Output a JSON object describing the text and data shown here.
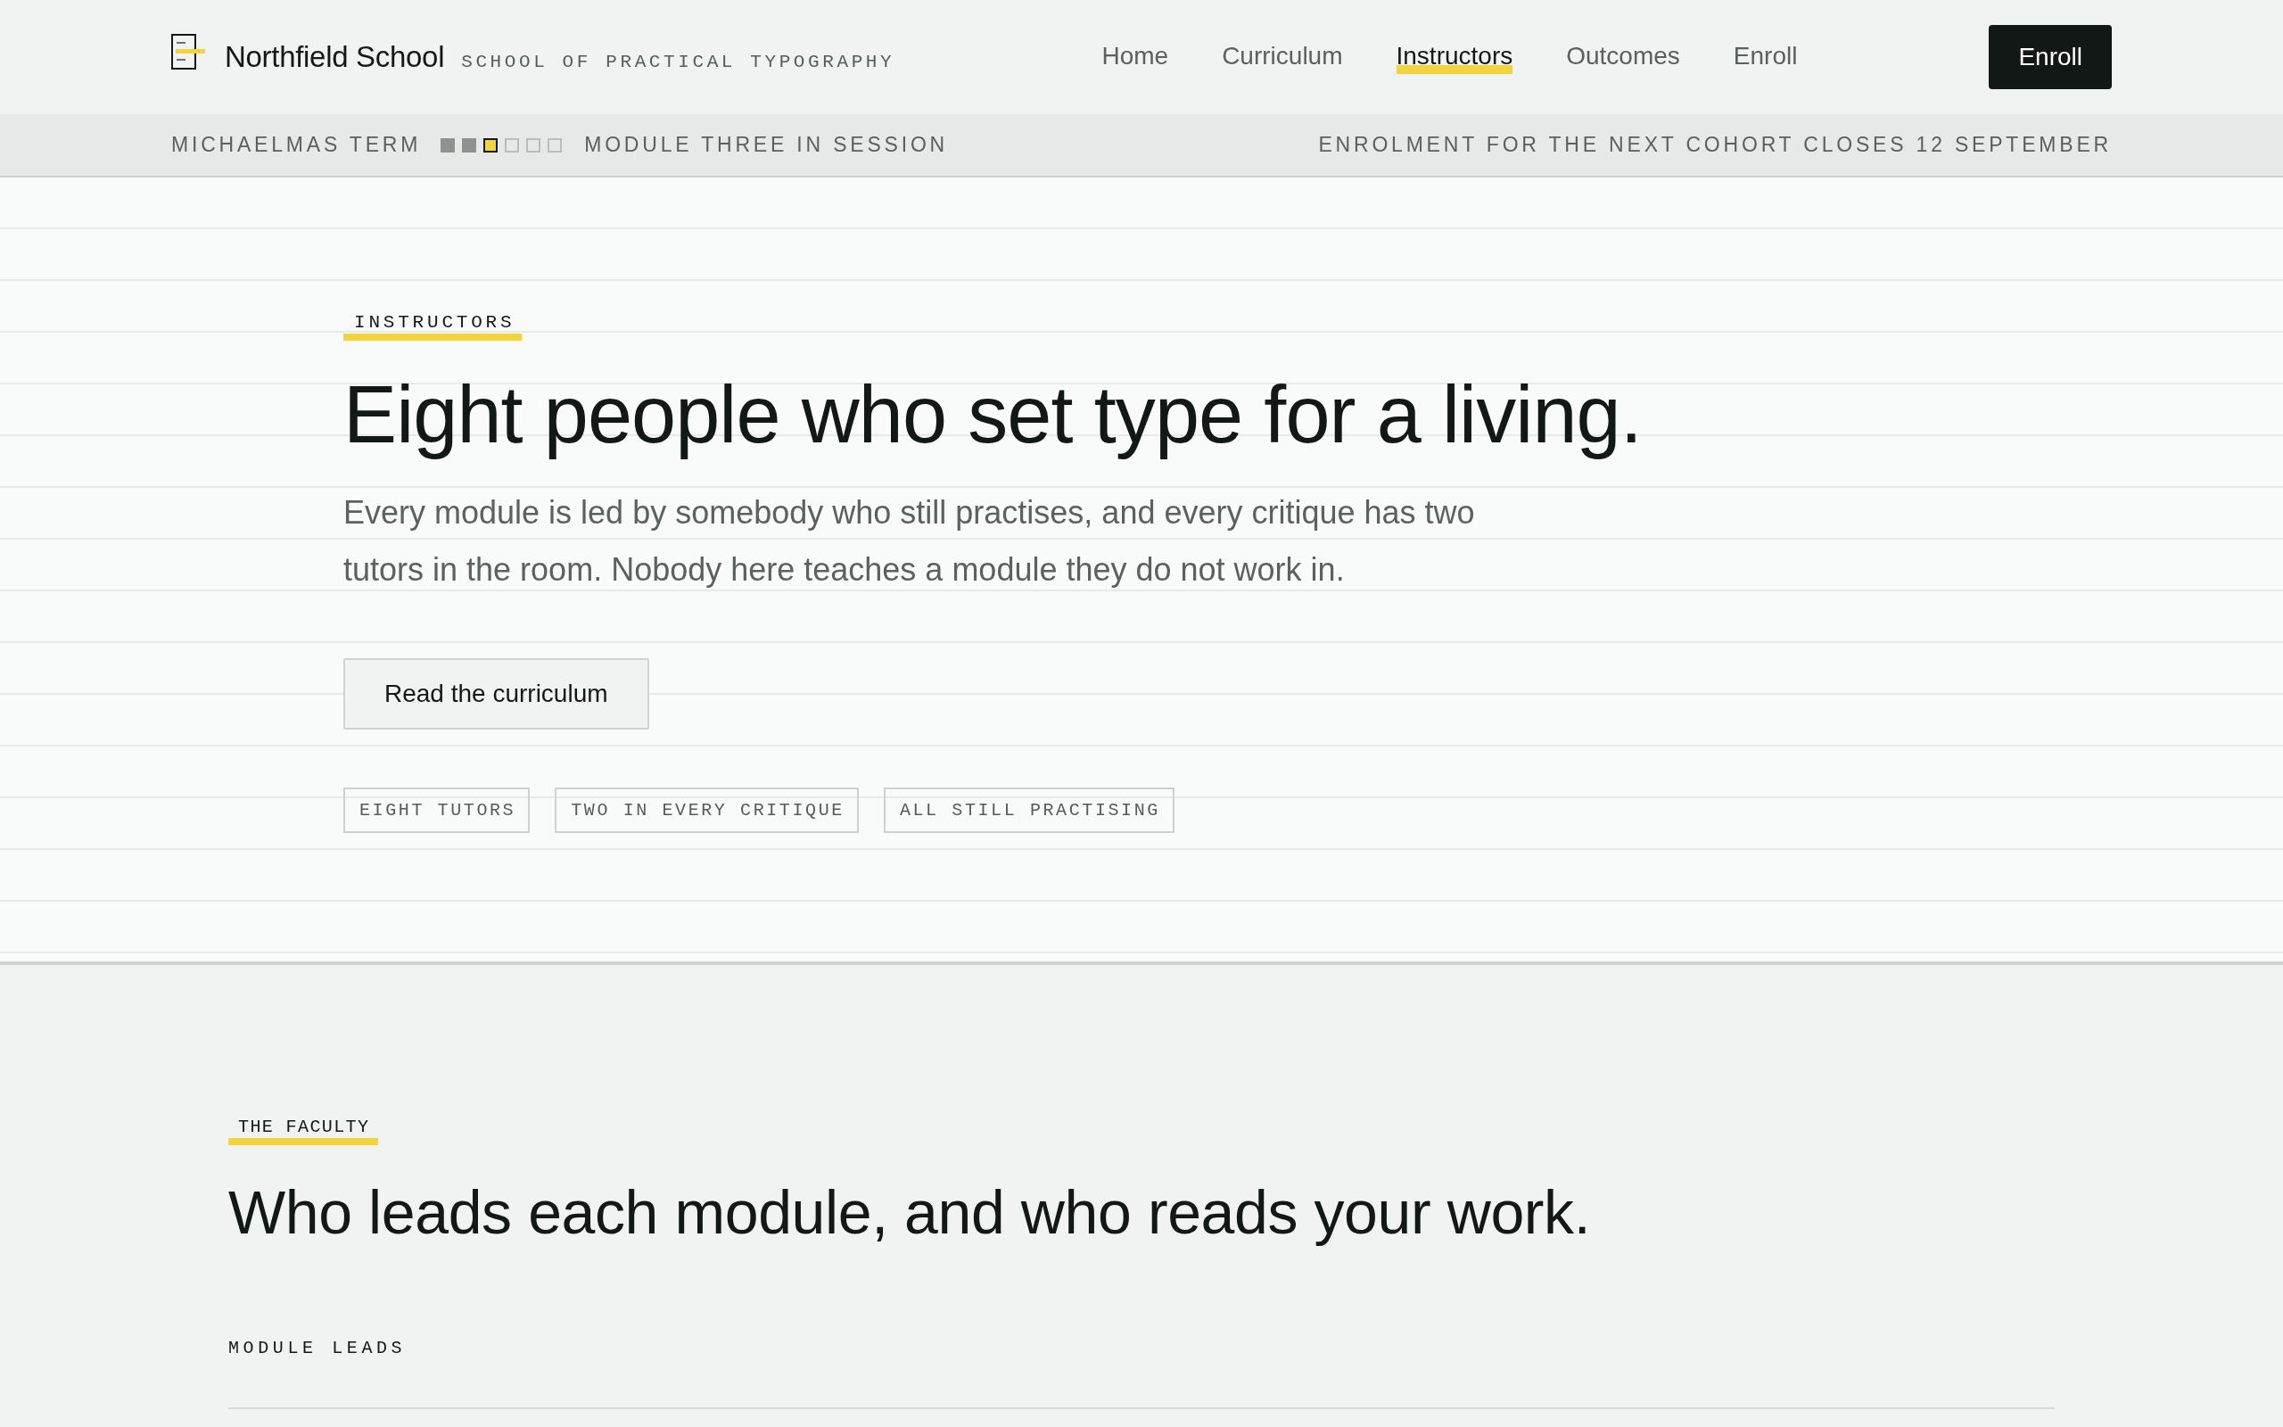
{
  "header": {
    "brand": {
      "name": "Northfield School",
      "tagline": "SCHOOL OF PRACTICAL TYPOGRAPHY"
    },
    "nav": [
      {
        "label": "Home",
        "selected": false
      },
      {
        "label": "Curriculum",
        "selected": false
      },
      {
        "label": "Instructors",
        "selected": true
      },
      {
        "label": "Outcomes",
        "selected": false
      },
      {
        "label": "Enroll",
        "selected": false
      }
    ],
    "cta": "Enroll"
  },
  "term_bar": {
    "term": "MICHAELMAS TERM",
    "modules": [
      {
        "done": true,
        "current": false
      },
      {
        "done": true,
        "current": false
      },
      {
        "done": false,
        "current": true
      },
      {
        "done": false,
        "current": false
      },
      {
        "done": false,
        "current": false
      },
      {
        "done": false,
        "current": false
      }
    ],
    "session": "MODULE THREE IN SESSION",
    "notice": "ENROLMENT FOR THE NEXT COHORT CLOSES 12 SEPTEMBER"
  },
  "hero": {
    "eyebrow": "INSTRUCTORS",
    "title": "Eight people who set type for a living.",
    "lede": "Every module is led by somebody who still practises, and every critique has two tutors in the room. Nobody here teaches a module they do not work in.",
    "button": "Read the curriculum",
    "tags": [
      "EIGHT TUTORS",
      "TWO IN EVERY CRITIQUE",
      "ALL STILL PRACTISING"
    ]
  },
  "faculty": {
    "eyebrow": "THE FACULTY",
    "title": "Who leads each module, and who reads your work.",
    "subheading": "MODULE LEADS"
  }
}
